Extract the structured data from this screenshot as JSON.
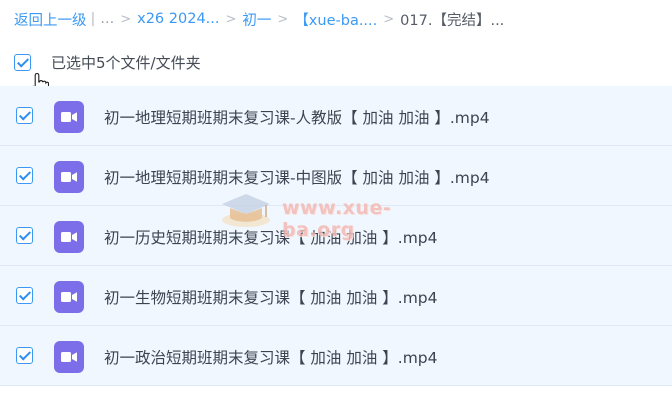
{
  "breadcrumb": {
    "back_label": "返回上一级",
    "ellipsis": "...",
    "items": [
      "x26 2024...",
      "初一",
      "【xue-ba....",
      "017.【完结】..."
    ],
    "separator": ">"
  },
  "selection": {
    "label": "已选中5个文件/文件夹",
    "checked": true
  },
  "files": [
    {
      "name": "初一地理短期班期末复习课-人教版【 加油 加油 】.mp4",
      "checked": true,
      "icon": "video-file-icon"
    },
    {
      "name": "初一地理短期班期末复习课-中图版【 加油 加油 】.mp4",
      "checked": true,
      "icon": "video-file-icon"
    },
    {
      "name": "初一历史短期班期末复习课【 加油 加油 】.mp4",
      "checked": true,
      "icon": "video-file-icon"
    },
    {
      "name": "初一生物短期班期末复习课【 加油 加油 】.mp4",
      "checked": true,
      "icon": "video-file-icon"
    },
    {
      "name": "初一政治短期班期末复习课【 加油 加油 】.mp4",
      "checked": true,
      "icon": "video-file-icon"
    }
  ],
  "watermark": {
    "text": "www.xue-ba.org"
  },
  "colors": {
    "accent": "#3b99f5",
    "row_selected_bg": "#f0f7ff",
    "video_icon": "#7b6ee8"
  }
}
